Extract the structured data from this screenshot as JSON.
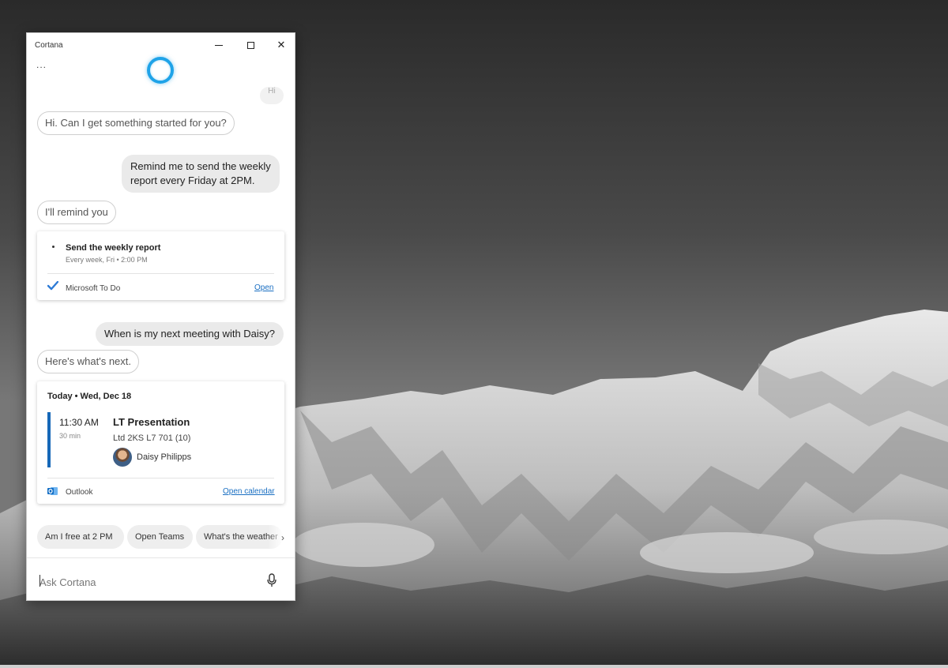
{
  "window": {
    "title": "Cortana",
    "more_label": "...",
    "close_label": "✕"
  },
  "conversation": {
    "partial_user_bubble": "Hi",
    "greeting": "Hi. Can I get something started for you?",
    "user_request_1": [
      "Remind me to send the weekly",
      "report every Friday at 2PM."
    ],
    "reply_1": "I'll remind you",
    "user_request_2": "When is my next meeting with Daisy?",
    "reply_2": "Here's what's next."
  },
  "reminder_card": {
    "title": "Send the weekly report",
    "subtitle": "Every week, Fri • 2:00 PM",
    "app": "Microsoft To Do",
    "link": "Open"
  },
  "meeting_card": {
    "date": "Today • Wed, Dec 18",
    "time": "11:30 AM",
    "duration": "30 min",
    "title": "LT Presentation",
    "room": "Ltd 2KS L7 701 (10)",
    "person": "Daisy Philipps",
    "app": "Outlook",
    "link": "Open calendar"
  },
  "suggestions": [
    "Am I free at 2 PM",
    "Open Teams",
    "What's the weather"
  ],
  "suggestions_next": "›",
  "input": {
    "placeholder": "Ask Cortana"
  },
  "icons": {
    "cortana": "cortana-ring-icon",
    "todo": "checkmark-icon",
    "outlook": "outlook-icon",
    "mic": "microphone-icon"
  },
  "colors": {
    "cortana_accent": "#1fa3e8",
    "link": "#1a6fc2",
    "calendar_bar": "#1668b8"
  }
}
